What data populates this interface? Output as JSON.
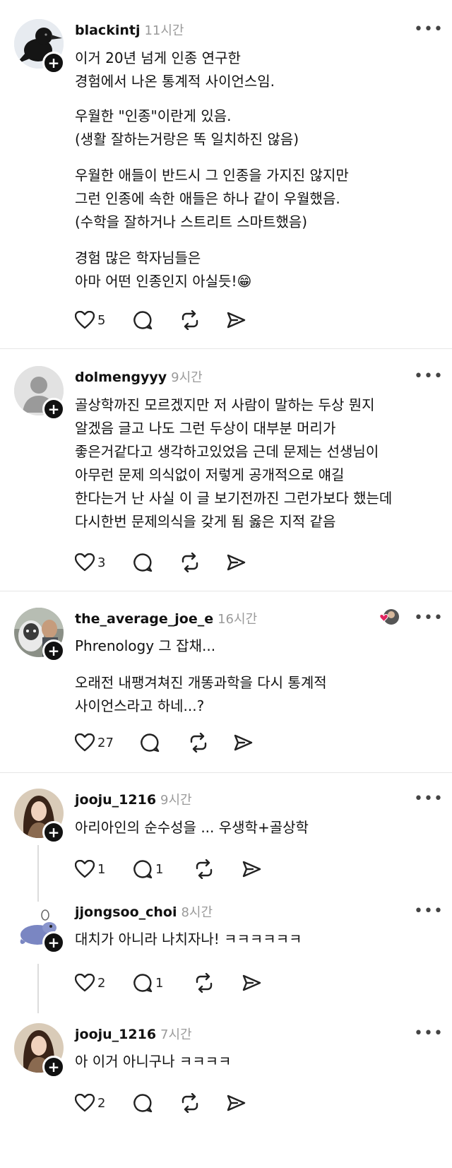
{
  "posts": [
    {
      "username": "blackintj",
      "time": "11시간",
      "paragraphs": [
        "이거 20년 넘게 인종 연구한\n경험에서 나온 통계적 사이언스임.",
        "우월한 \"인종\"이란게 있음.\n(생활 잘하는거랑은 똑 일치하진 않음)",
        "우월한 애들이 반드시 그 인종을 가지진 않지만\n그런 인종에 속한 애들은 하나 같이 우월했음.\n(수학을 잘하거나 스트리트 스마트했음)",
        "경험 많은 학자님들은\n아마 어떤 인종인지 아실듯!😁"
      ],
      "likes": "5",
      "replies": ""
    },
    {
      "username": "dolmengyyy",
      "time": "9시간",
      "paragraphs": [
        "골상학까진 모르겠지만 저 사람이 말하는 두상 뭔지\n알겠음 글고 나도 그런 두상이 대부분 머리가\n좋은거같다고 생각하고있었음 근데 문제는 선생님이\n아무런 문제 의식없이 저렇게 공개적으로 얘길\n한다는거 난 사실 이 글 보기전까진 그런가보다 했는데\n다시한번 문제의식을 갖게 됨 옳은 지적 같음"
      ],
      "likes": "3",
      "replies": ""
    },
    {
      "username": "the_average_joe_e",
      "time": "16시간",
      "paragraphs": [
        "Phrenology 그 잡채...",
        "오래전 내팽겨쳐진 개똥과학을 다시 통계적\n사이언스라고 하네...?"
      ],
      "likes": "27",
      "replies": ""
    },
    {
      "username": "jooju_1216",
      "time": "9시간",
      "paragraphs": [
        "아리아인의 순수성을 ... 우생학+골상학"
      ],
      "likes": "1",
      "replies": "1"
    },
    {
      "username": "jjongsoo_choi",
      "time": "8시간",
      "paragraphs": [
        "대치가 아니라 나치자나! ㅋㅋㅋㅋㅋㅋ"
      ],
      "likes": "2",
      "replies": "1"
    },
    {
      "username": "jooju_1216",
      "time": "7시간",
      "paragraphs": [
        "아 이거 아니구나 ㅋㅋㅋㅋ"
      ],
      "likes": "2",
      "replies": ""
    }
  ],
  "icons": {
    "more": "more-horizontal-icon",
    "like": "heart-icon",
    "reply": "comment-bubble-icon",
    "repost": "repost-icon",
    "share": "send-icon",
    "follow": "plus-icon"
  },
  "colors": {
    "text": "#111111",
    "time": "#9a9a9a",
    "divider": "#e6e6e6",
    "badge_heart": "#e0245e"
  }
}
